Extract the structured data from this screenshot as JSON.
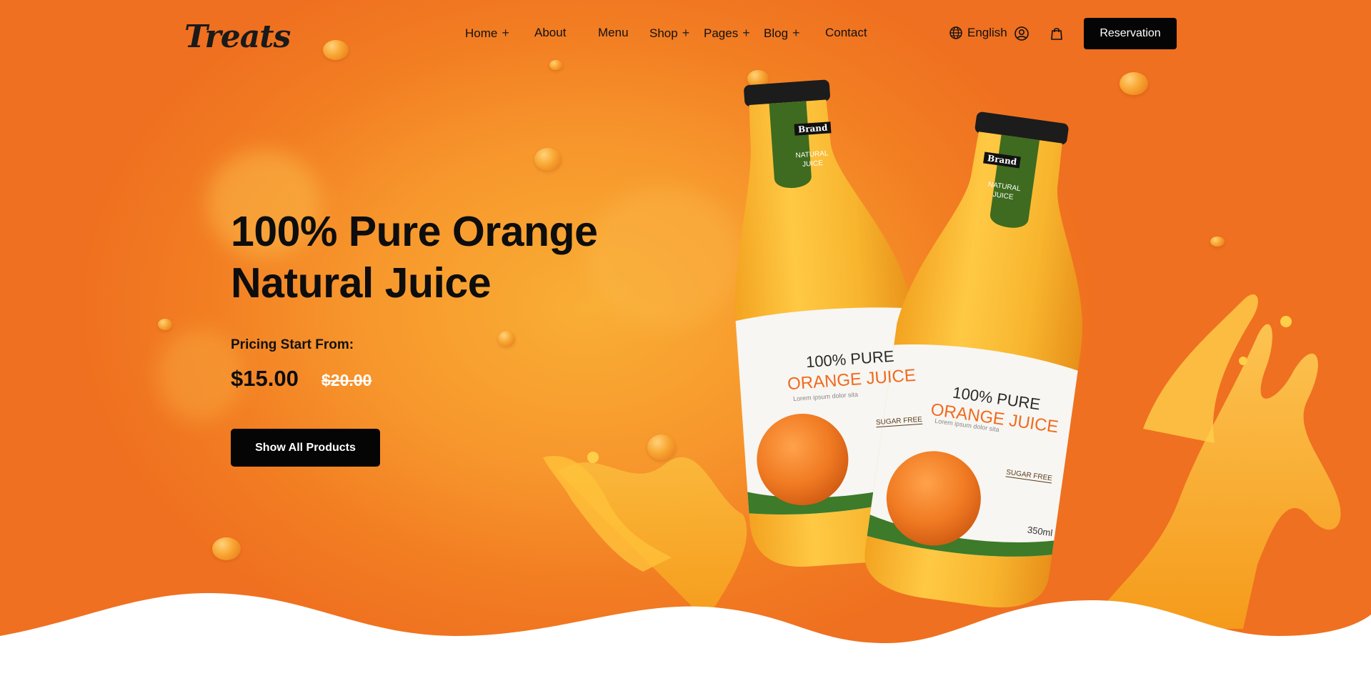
{
  "header": {
    "logo": "Treats",
    "nav": [
      {
        "label": "Home",
        "has_submenu": true
      },
      {
        "label": "About",
        "has_submenu": false
      },
      {
        "label": "Menu",
        "has_submenu": false
      },
      {
        "label": "Shop",
        "has_submenu": true
      },
      {
        "label": "Pages",
        "has_submenu": true
      },
      {
        "label": "Blog",
        "has_submenu": true
      },
      {
        "label": "Contact",
        "has_submenu": false
      }
    ],
    "submenu_glyph": "+",
    "language": "English",
    "reservation_label": "Reservation",
    "icons": [
      "globe-icon",
      "user-icon",
      "shopping-bag-icon"
    ]
  },
  "hero": {
    "headline": "100% Pure Orange Natural Juice",
    "pricing_label": "Pricing Start From:",
    "price": "$15.00",
    "old_price": "$20.00",
    "cta_label": "Show All Products"
  },
  "product": {
    "cap_brand": "Brand",
    "cap_text": "NATURAL JUICE",
    "label_line1": "100% PURE",
    "label_line2": "ORANGE JUICE",
    "label_sub": "Lorem ipsum dolor sita",
    "label_badge": "SUGAR FREE",
    "volume": "350ml"
  },
  "colors": {
    "hero_orange": "#f7962c",
    "button_black": "#050505",
    "bottle_green": "#3e6b1f",
    "label_orange": "#f06a1e"
  }
}
